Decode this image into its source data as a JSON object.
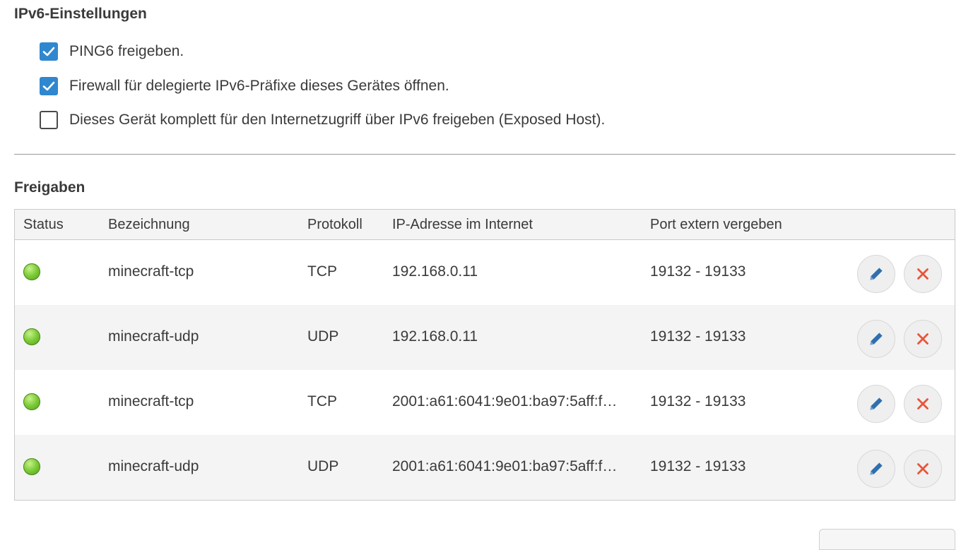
{
  "ipv6": {
    "title": "IPv6-Einstellungen",
    "options": [
      {
        "label": "PING6 freigeben.",
        "checked": true
      },
      {
        "label": "Firewall für delegierte IPv6-Präfixe dieses Gerätes öffnen.",
        "checked": true
      },
      {
        "label": "Dieses Gerät komplett für den Internetzugriff über IPv6 freigeben (Exposed Host).",
        "checked": false
      }
    ]
  },
  "freigaben": {
    "title": "Freigaben",
    "columns": {
      "status": "Status",
      "name": "Bezeichnung",
      "protocol": "Protokoll",
      "ip": "IP-Adresse im Internet",
      "port": "Port extern vergeben"
    },
    "rows": [
      {
        "status": "active",
        "name": "minecraft-tcp",
        "protocol": "TCP",
        "ip": "192.168.0.11",
        "port": "19132 - 19133"
      },
      {
        "status": "active",
        "name": "minecraft-udp",
        "protocol": "UDP",
        "ip": "192.168.0.11",
        "port": "19132 - 19133"
      },
      {
        "status": "active",
        "name": "minecraft-tcp",
        "protocol": "TCP",
        "ip": "2001:a61:6041:9e01:ba97:5aff:f…",
        "port": "19132 - 19133"
      },
      {
        "status": "active",
        "name": "minecraft-udp",
        "protocol": "UDP",
        "ip": "2001:a61:6041:9e01:ba97:5aff:f…",
        "port": "19132 - 19133"
      }
    ]
  },
  "icons": {
    "checkbox_check": "check-icon",
    "edit": "pencil-icon",
    "delete": "close-icon",
    "status": "status-led-icon"
  },
  "colors": {
    "accent": "#2f87cf",
    "edit_icon": "#2f6fb0",
    "delete_icon": "#e8553a",
    "status_active": "#7fcc3a"
  }
}
